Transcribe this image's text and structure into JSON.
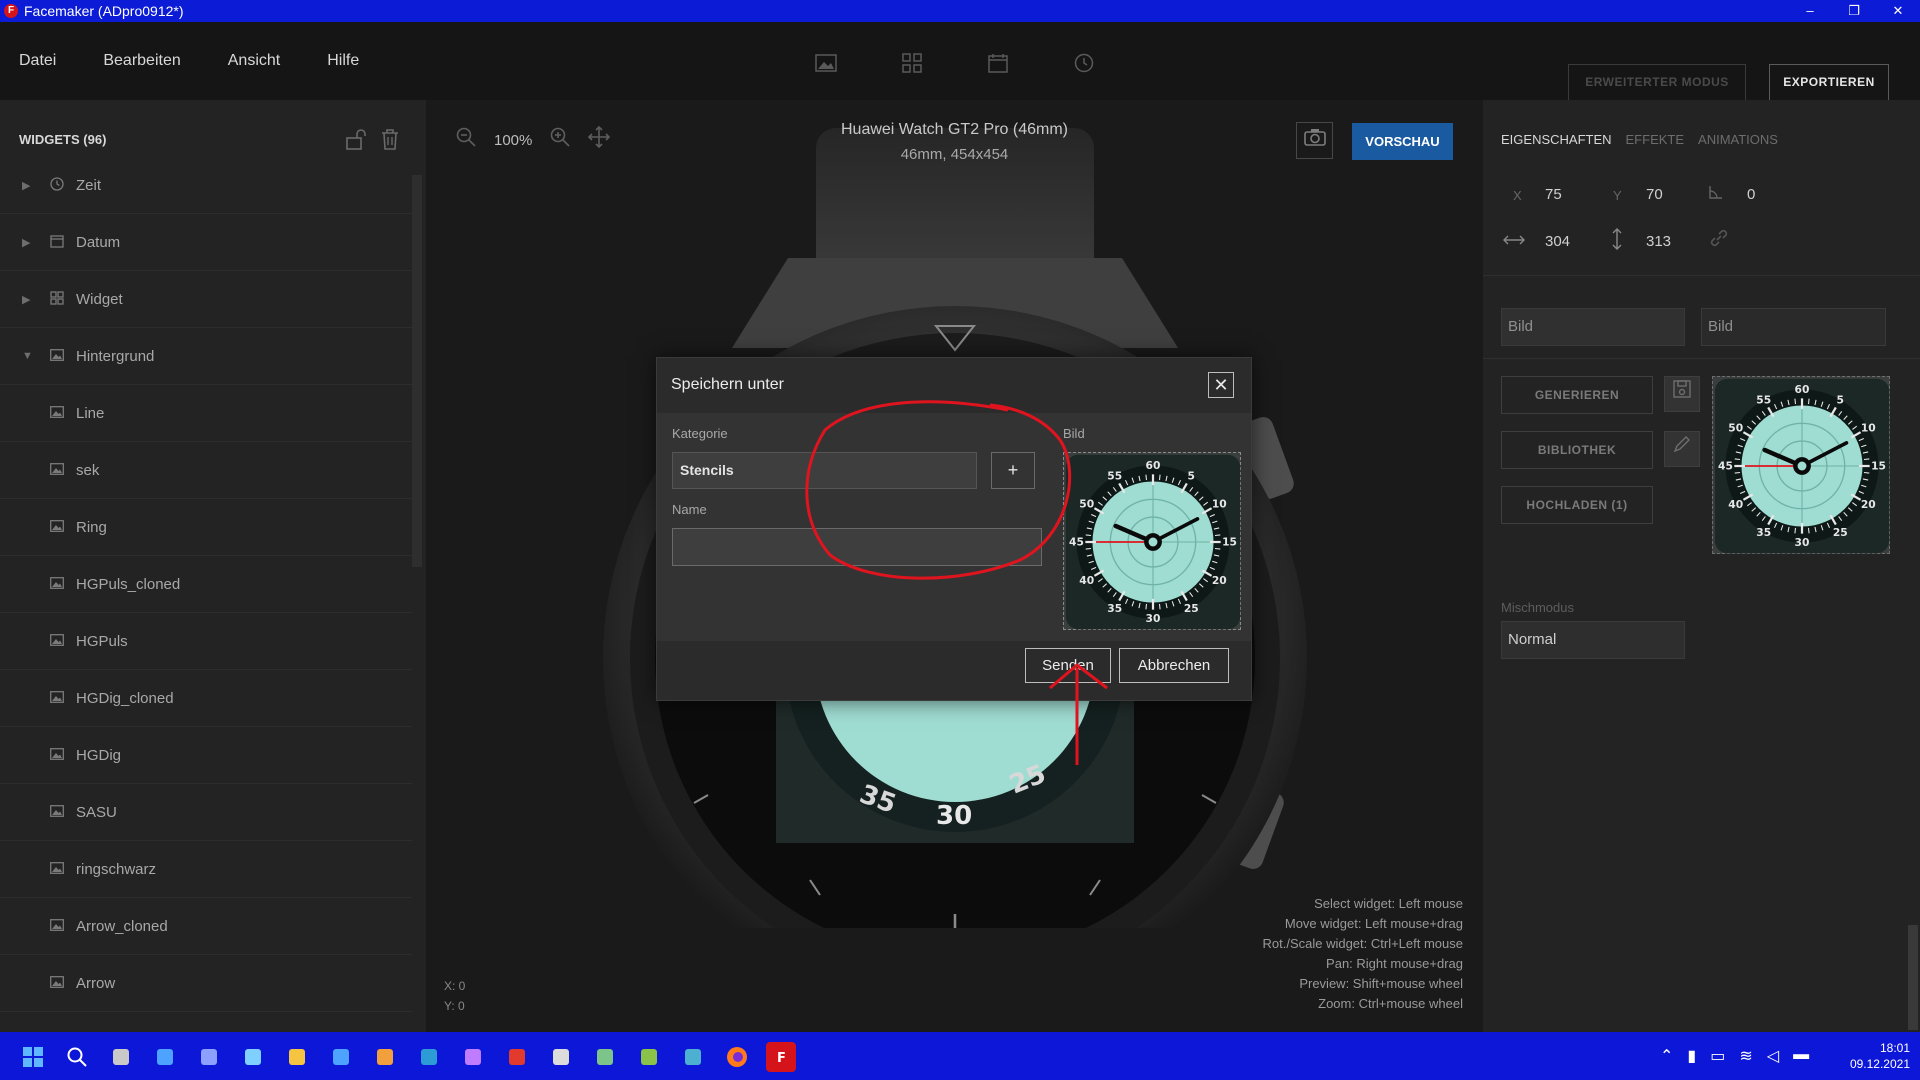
{
  "window": {
    "title": "Facemaker (ADpro0912*)",
    "logo_letter": "F",
    "controls": {
      "minimize": "–",
      "restore": "❐",
      "close": "✕"
    }
  },
  "menu": {
    "items": [
      "Datei",
      "Bearbeiten",
      "Ansicht",
      "Hilfe"
    ],
    "extended_mode": "ERWEITERTER MODUS",
    "export": "EXPORTIEREN"
  },
  "widgets_panel": {
    "header": "WIDGETS (96)",
    "items": [
      {
        "label": "Zeit",
        "level": 0,
        "expandable": true,
        "icon": "clock-icon"
      },
      {
        "label": "Datum",
        "level": 0,
        "expandable": true,
        "icon": "calendar-icon"
      },
      {
        "label": "Widget",
        "level": 0,
        "expandable": true,
        "icon": "grid-icon"
      },
      {
        "label": "Hintergrund",
        "level": 0,
        "expandable": true,
        "expanded": true,
        "icon": "image-icon"
      },
      {
        "label": "Line",
        "level": 1,
        "icon": "image-icon"
      },
      {
        "label": "sek",
        "level": 1,
        "icon": "image-icon"
      },
      {
        "label": "Ring",
        "level": 1,
        "icon": "image-icon"
      },
      {
        "label": "HGPuls_cloned",
        "level": 1,
        "icon": "image-icon"
      },
      {
        "label": "HGPuls",
        "level": 1,
        "icon": "image-icon"
      },
      {
        "label": "HGDig_cloned",
        "level": 1,
        "icon": "image-icon"
      },
      {
        "label": "HGDig",
        "level": 1,
        "icon": "image-icon"
      },
      {
        "label": "SASU",
        "level": 1,
        "icon": "image-icon"
      },
      {
        "label": "ringschwarz",
        "level": 1,
        "icon": "image-icon"
      },
      {
        "label": "Arrow_cloned",
        "level": 1,
        "icon": "image-icon"
      },
      {
        "label": "Arrow",
        "level": 1,
        "icon": "image-icon"
      }
    ]
  },
  "canvas": {
    "zoom": "100%",
    "device_name": "Huawei Watch GT2 Pro (46mm)",
    "device_res": "46mm, 454x454",
    "preview": "VORSCHAU",
    "dial_numbers": [
      "35",
      "30",
      "25"
    ],
    "hints": [
      "Select widget: Left mouse",
      "Move widget: Left mouse+drag",
      "Rot./Scale widget: Ctrl+Left mouse",
      "Pan: Right mouse+drag",
      "Preview: Shift+mouse wheel",
      "Zoom: Ctrl+mouse wheel"
    ],
    "coord_x": "X: 0",
    "coord_y": "Y: 0"
  },
  "properties": {
    "tabs": [
      "EIGENSCHAFTEN",
      "EFFEKTE",
      "ANIMATIONS"
    ],
    "x_label": "X",
    "x": "75",
    "y_label": "Y",
    "y": "70",
    "angle": "0",
    "width": "304",
    "height": "313",
    "image_field_1": "Bild",
    "image_field_2": "Bild",
    "generate": "GENERIEREN",
    "library": "BIBLIOTHEK",
    "upload": "HOCHLADEN (1)",
    "blend_label": "Mischmodus",
    "blend_value": "Normal"
  },
  "dialog": {
    "title": "Speichern unter",
    "category_label": "Kategorie",
    "category_value": "Stencils",
    "add": "+",
    "name_label": "Name",
    "name_value": "",
    "image_label": "Bild",
    "send": "Senden",
    "cancel": "Abbrechen",
    "close": "✕"
  },
  "watch_face": {
    "numbers": [
      "60",
      "5",
      "10",
      "15",
      "20",
      "25",
      "30",
      "35",
      "40",
      "45",
      "50",
      "55"
    ]
  },
  "annotation_color": "#e0141e",
  "taskbar": {
    "apps": [
      "windows-start-icon",
      "search-icon",
      "task-view-icon",
      "widgets-icon",
      "chat-icon",
      "remote-icon",
      "explorer-icon",
      "app-l-icon",
      "app-photo-icon",
      "skype-icon",
      "drop-icon",
      "acrobat-icon",
      "security-icon",
      "app-doc-icon",
      "app-sheet-icon",
      "app-img-icon",
      "firefox-icon",
      "facemaker-icon"
    ],
    "time": "18:01",
    "date": "09.12.2021"
  }
}
